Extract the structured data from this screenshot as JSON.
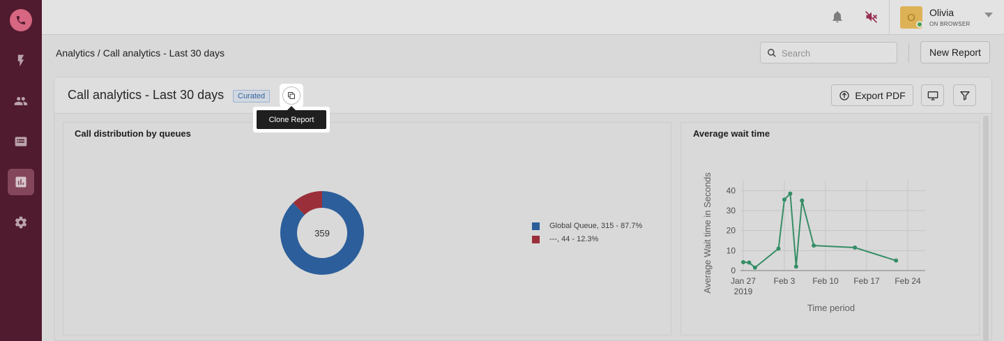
{
  "user": {
    "name": "Olivia",
    "status": "ON BROWSER",
    "initial": "O"
  },
  "breadcrumb": {
    "root": "Analytics",
    "separator": "/",
    "current": "Call analytics - Last 30 days"
  },
  "search": {
    "placeholder": "Search"
  },
  "buttons": {
    "new_report": "New Report",
    "export_pdf": "Export PDF"
  },
  "report": {
    "title": "Call analytics - Last 30 days",
    "badge": "Curated",
    "tooltip": "Clone Report"
  },
  "sidebar": {
    "items": [
      "calls",
      "automation",
      "contacts",
      "tickets",
      "analytics",
      "settings"
    ],
    "active": "analytics"
  },
  "panels": {
    "distribution": {
      "title": "Call distribution by queues"
    },
    "wait_time": {
      "title": "Average wait time"
    }
  },
  "chart_data": [
    {
      "type": "pie",
      "title": "Call distribution by queues",
      "center_label": "359",
      "slices": [
        {
          "name": "Global Queue",
          "value": 315,
          "percent": 87.7,
          "label": "Global Queue,",
          "detail": "315 - 87.7%",
          "color": "#2f66a8"
        },
        {
          "name": "---",
          "value": 44,
          "percent": 12.3,
          "label": "---,",
          "detail": "44 - 12.3%",
          "color": "#a8343f"
        }
      ]
    },
    {
      "type": "line",
      "title": "Average wait time",
      "xlabel": "Time period",
      "ylabel": "Average Wait time in Seconds",
      "ylim": [
        0,
        45
      ],
      "yticks": [
        0,
        10,
        20,
        30,
        40
      ],
      "xticks": [
        {
          "date": "2019-01-27",
          "label": "Jan 27",
          "sub": "2019"
        },
        {
          "date": "2019-02-03",
          "label": "Feb 3"
        },
        {
          "date": "2019-02-10",
          "label": "Feb 10"
        },
        {
          "date": "2019-02-17",
          "label": "Feb 17"
        },
        {
          "date": "2019-02-24",
          "label": "Feb 24"
        }
      ],
      "grid": true,
      "color": "#3a9a6e",
      "series": [
        {
          "points": [
            {
              "x": "2019-01-27",
              "y": 4.2
            },
            {
              "x": "2019-01-28",
              "y": 4
            },
            {
              "x": "2019-01-29",
              "y": 1.5
            },
            {
              "x": "2019-02-02",
              "y": 11
            },
            {
              "x": "2019-02-03",
              "y": 35.5
            },
            {
              "x": "2019-02-04",
              "y": 38.5
            },
            {
              "x": "2019-02-05",
              "y": 2
            },
            {
              "x": "2019-02-06",
              "y": 35
            },
            {
              "x": "2019-02-08",
              "y": 12.5
            },
            {
              "x": "2019-02-15",
              "y": 11.5
            },
            {
              "x": "2019-02-22",
              "y": 5
            }
          ]
        }
      ]
    }
  ]
}
